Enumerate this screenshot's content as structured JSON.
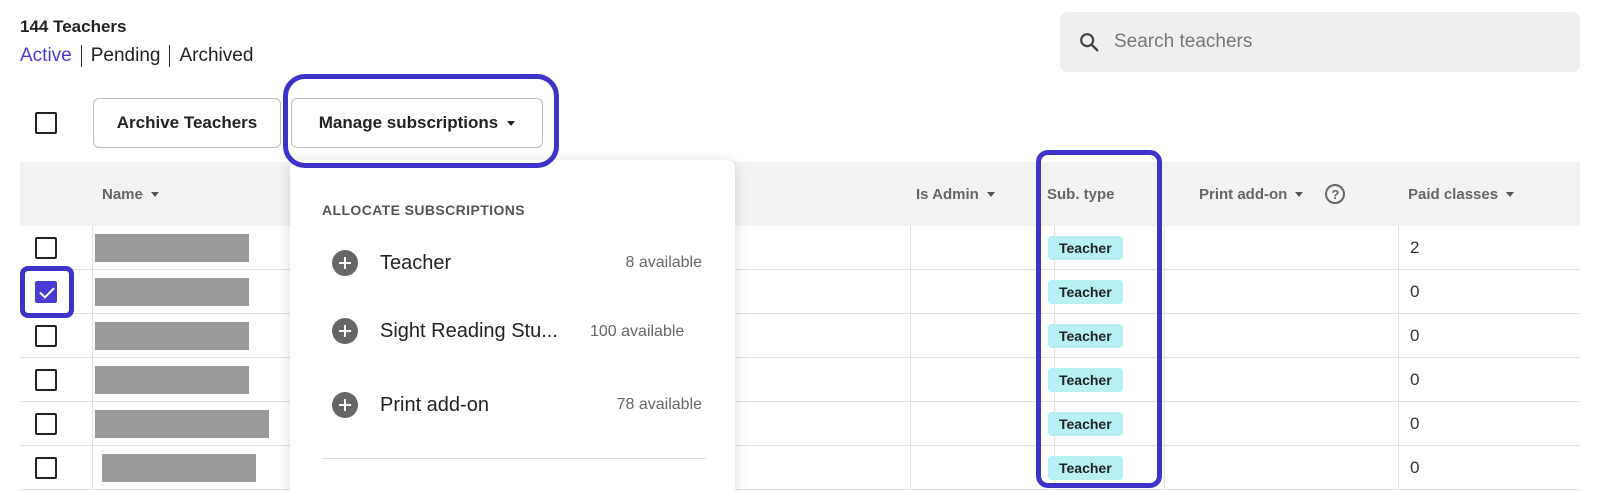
{
  "header": {
    "count_title": "144 Teachers",
    "filters": [
      "Active",
      "Pending",
      "Archived"
    ],
    "active_filter": "Active"
  },
  "search": {
    "placeholder": "Search teachers",
    "value": ""
  },
  "toolbar": {
    "archive_label": "Archive Teachers",
    "manage_label": "Manage subscriptions"
  },
  "table": {
    "columns": {
      "name": "Name",
      "is_admin": "Is Admin",
      "sub_type": "Sub. type",
      "print_addon": "Print add-on",
      "paid_classes": "Paid classes"
    },
    "rows": [
      {
        "checked": false,
        "sub_type": "Teacher",
        "paid_classes": "2"
      },
      {
        "checked": true,
        "sub_type": "Teacher",
        "paid_classes": "0"
      },
      {
        "checked": false,
        "sub_type": "Teacher",
        "paid_classes": "0"
      },
      {
        "checked": false,
        "sub_type": "Teacher",
        "paid_classes": "0"
      },
      {
        "checked": false,
        "sub_type": "Teacher",
        "paid_classes": "0"
      },
      {
        "checked": false,
        "sub_type": "Teacher",
        "paid_classes": "0"
      }
    ]
  },
  "dropdown": {
    "title": "ALLOCATE SUBSCRIPTIONS",
    "items": [
      {
        "label": "Teacher",
        "available": "8 available"
      },
      {
        "label": "Sight Reading Stu...",
        "available": "100 available"
      },
      {
        "label": "Print add-on",
        "available": "78 available"
      }
    ]
  },
  "colors": {
    "accent": "#4a3ad4",
    "highlight": "#3f32c9",
    "badge_bg": "#b7f0f5"
  },
  "icons": {
    "search": "search-icon",
    "add": "plus-circle-icon",
    "help": "help-circle-icon",
    "sort": "caret-down-icon",
    "check": "checkmark-icon"
  }
}
